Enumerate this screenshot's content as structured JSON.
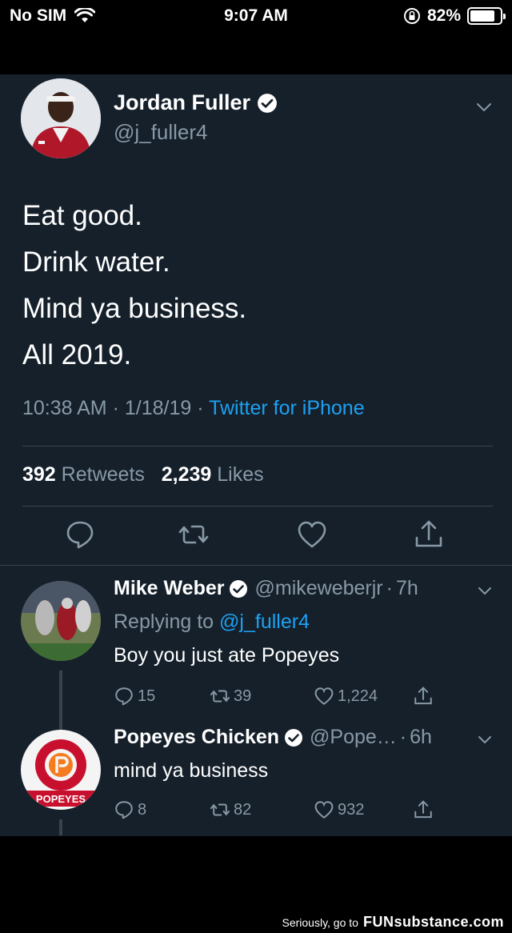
{
  "status_bar": {
    "carrier": "No SIM",
    "time": "9:07 AM",
    "battery": "82%",
    "battery_fraction": 0.82
  },
  "tweet": {
    "author_name": "Jordan Fuller",
    "author_handle": "@j_fuller4",
    "lines": [
      "Eat good.",
      "Drink water.",
      "Mind ya business.",
      "All 2019."
    ],
    "time": "10:38 AM",
    "date": "1/18/19",
    "source": "Twitter for iPhone",
    "retweets_count": "392",
    "retweets_label": "Retweets",
    "likes_count": "2,239",
    "likes_label": "Likes"
  },
  "replies": [
    {
      "name": "Mike Weber",
      "handle": "@mikeweberjr",
      "age": "7h",
      "replying_prefix": "Replying to",
      "replying_to": "@j_fuller4",
      "text": "Boy you just ate Popeyes",
      "reply_count": "15",
      "retweet_count": "39",
      "like_count": "1,224"
    },
    {
      "name": "Popeyes Chicken",
      "handle": "@Pope…",
      "age": "6h",
      "text": "mind ya business",
      "reply_count": "8",
      "retweet_count": "82",
      "like_count": "932",
      "logo_text": "POPEYES"
    }
  ],
  "watermark": {
    "prefix": "Seriously, go to",
    "brand": "FUNsubstance.com"
  },
  "colors": {
    "background": "#15202b",
    "accent": "#1da1f2",
    "muted": "#8899a6",
    "divider": "#38444d"
  }
}
